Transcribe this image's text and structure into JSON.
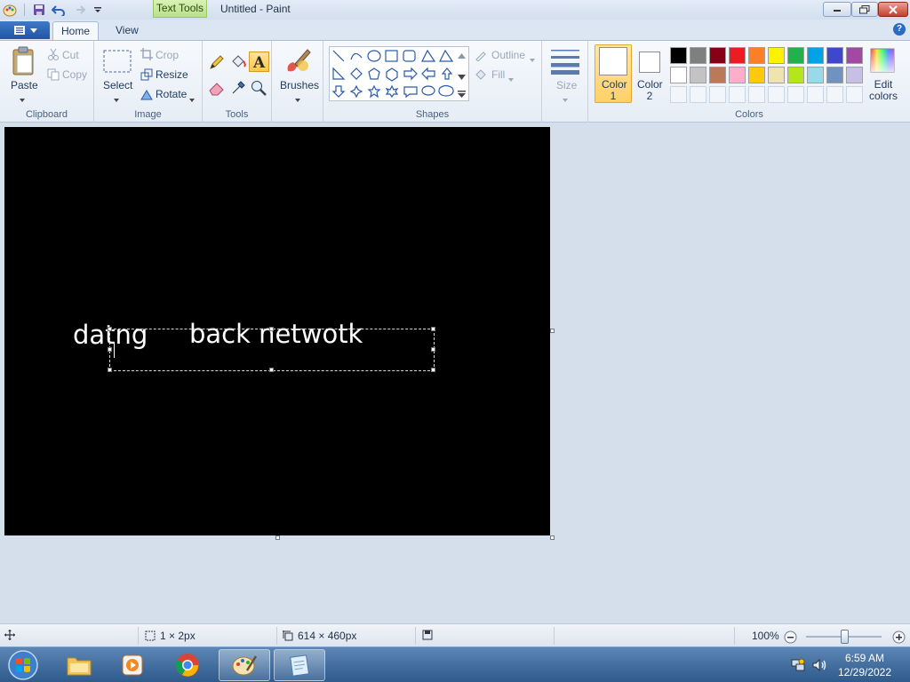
{
  "window": {
    "title": "Untitled - Paint",
    "context_tab": "Text Tools"
  },
  "tabs": {
    "home": "Home",
    "view": "View"
  },
  "ribbon": {
    "clipboard": {
      "label": "Clipboard",
      "paste": "Paste",
      "cut": "Cut",
      "copy": "Copy"
    },
    "image": {
      "label": "Image",
      "select": "Select",
      "crop": "Crop",
      "resize": "Resize",
      "rotate": "Rotate"
    },
    "tools": {
      "label": "Tools"
    },
    "brushes": {
      "label": "Brushes"
    },
    "shapes": {
      "label": "Shapes",
      "outline": "Outline",
      "fill": "Fill"
    },
    "size": {
      "label": "Size"
    },
    "colors": {
      "label": "Colors",
      "color1": [
        "Color",
        "1"
      ],
      "color2": [
        "Color",
        "2"
      ],
      "edit": [
        "Edit",
        "colors"
      ],
      "row1": [
        "#000000",
        "#7f7f7f",
        "#880015",
        "#ed1c24",
        "#ff7f27",
        "#fff200",
        "#22b14c",
        "#00a2e8",
        "#3f48cc",
        "#a349a4"
      ],
      "row2": [
        "#ffffff",
        "#c3c3c3",
        "#b97a57",
        "#ffaec9",
        "#ffc90e",
        "#efe4b0",
        "#b5e61d",
        "#99d9ea",
        "#7092be",
        "#c8bfe7"
      ]
    }
  },
  "canvas": {
    "text1": "datng",
    "text2": "back netwotk"
  },
  "status": {
    "selection": "1 × 2px",
    "image_size": "614 × 460px",
    "zoom": "100%"
  },
  "clock": {
    "time": "6:59 AM",
    "date": "12/29/2022"
  }
}
